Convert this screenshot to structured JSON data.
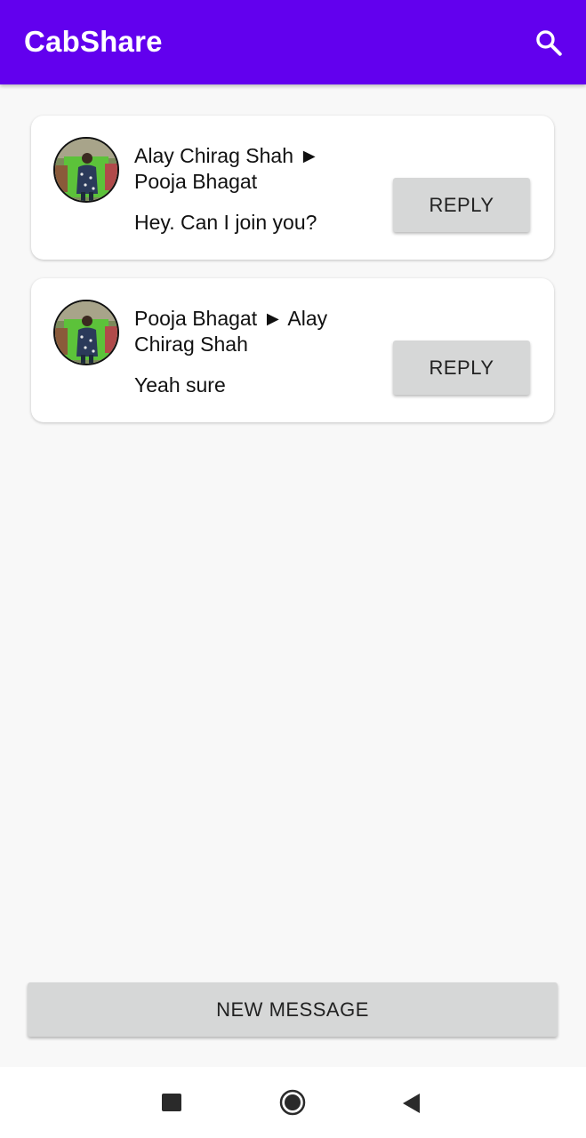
{
  "app": {
    "title": "CabShare"
  },
  "toolbar": {
    "search_icon": "search-icon"
  },
  "messages": [
    {
      "header": "Alay Chirag Shah ► Pooja Bhagat",
      "text": "Hey. Can I join you?",
      "reply_label": "REPLY"
    },
    {
      "header": "Pooja Bhagat ► Alay Chirag Shah",
      "text": "Yeah sure",
      "reply_label": "REPLY"
    }
  ],
  "footer": {
    "new_message_label": "NEW MESSAGE"
  },
  "navbar": {
    "icons": [
      "recents-icon",
      "home-icon",
      "back-icon"
    ]
  },
  "colors": {
    "primary": "#6200ee",
    "button": "#d6d7d7",
    "background": "#f8f8f8"
  }
}
